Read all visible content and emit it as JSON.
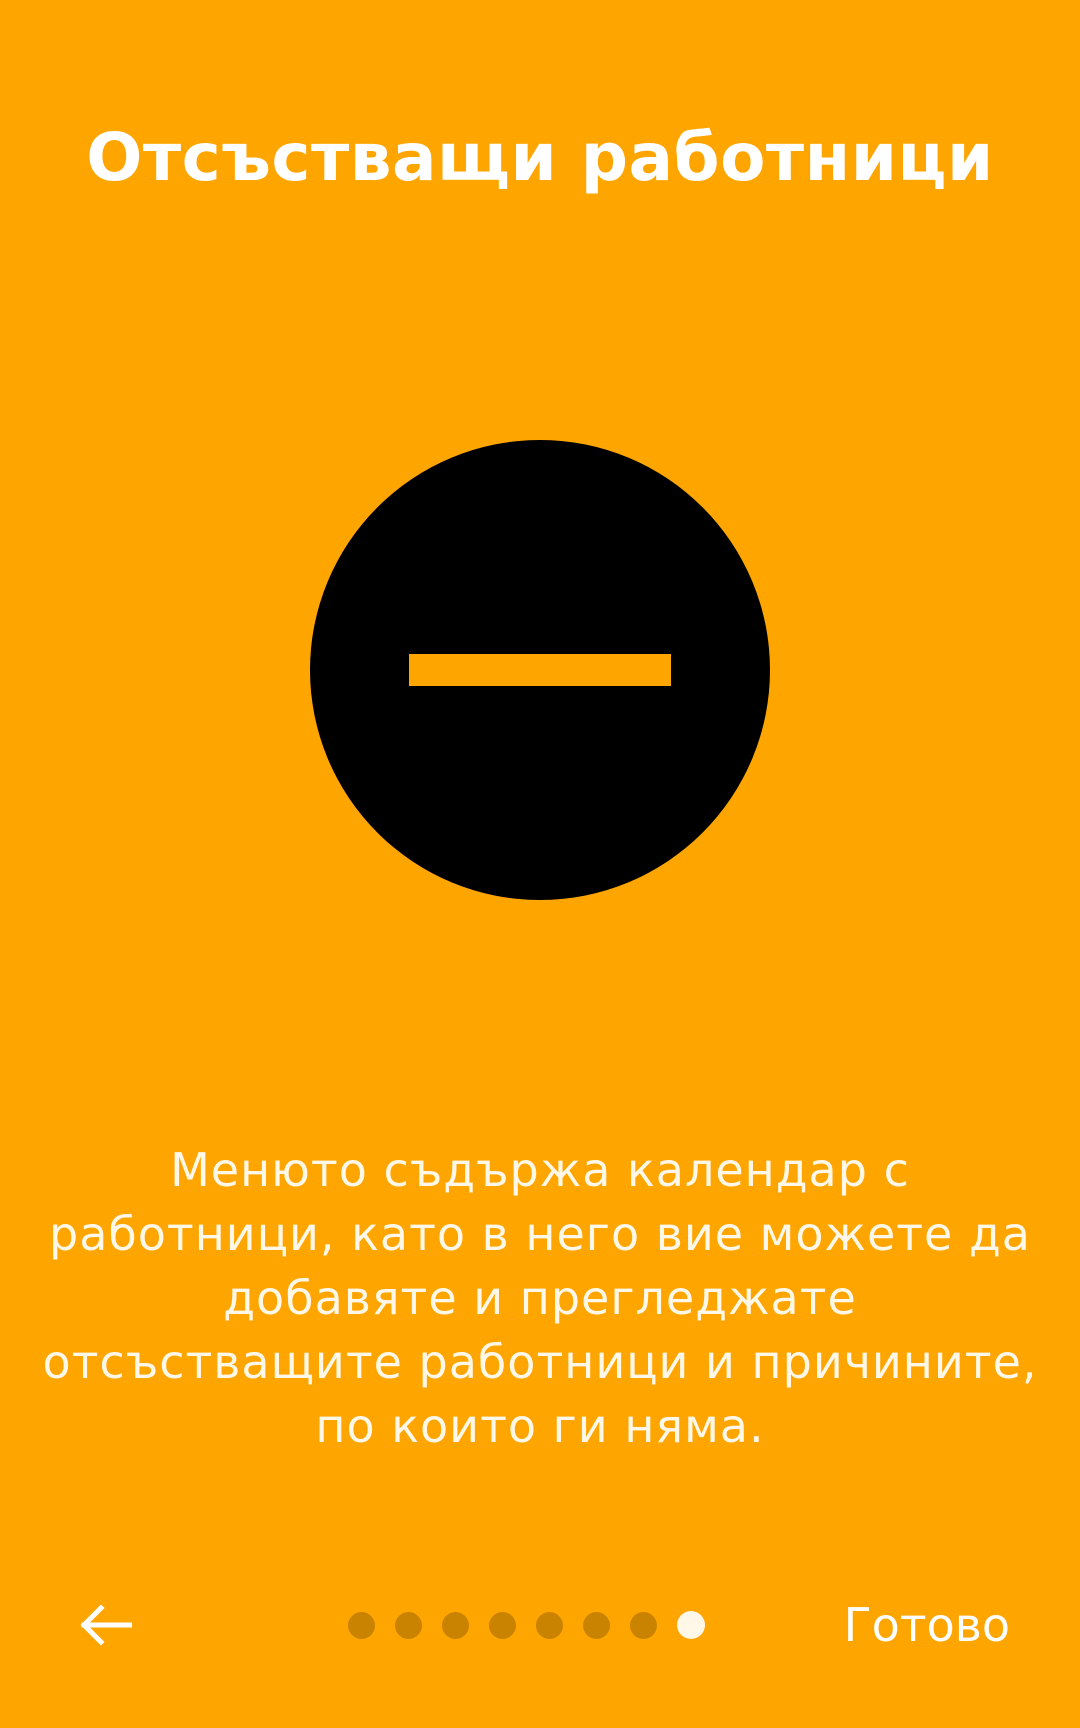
{
  "onboarding": {
    "title": "Отсъстващи работници",
    "description": "Менюто съдържа календар с работници, като в него вие можете да добавяте и прегледжате отсъстващите работници и причините, по които ги няма.",
    "hero_icon": "minus-circle-icon",
    "colors": {
      "background": "#FFA500",
      "icon_circle": "#000000",
      "icon_bar": "#FFA500",
      "text": "#FFFFFF",
      "dot_inactive": "#C98300",
      "dot_active": "#FFF8E8"
    }
  },
  "navigation": {
    "back_icon": "arrow-left-icon",
    "done_label": "Готово",
    "page_count": 8,
    "current_page": 8
  }
}
